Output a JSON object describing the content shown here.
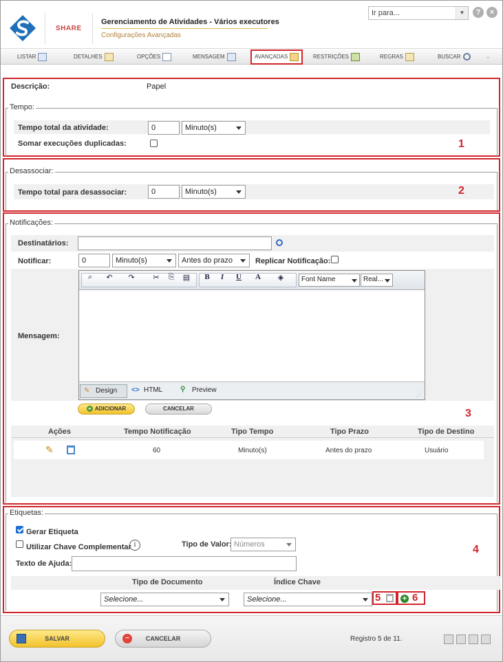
{
  "header": {
    "brand": "SHARE",
    "title": "Gerenciamento de Atividades - Vários executores",
    "subtitle": "Configurações Avançadas",
    "goto_label": "Ir para...",
    "help_icon": "?",
    "close_icon": "×"
  },
  "tabs": [
    {
      "label": "LISTAR"
    },
    {
      "label": "DETALHES"
    },
    {
      "label": "OPÇÕES"
    },
    {
      "label": "MENSAGEM"
    },
    {
      "label": "AVANÇADAS"
    },
    {
      "label": "RESTRIÇÕES"
    },
    {
      "label": "REGRAS"
    },
    {
      "label": "BUSCAR"
    }
  ],
  "section1": {
    "descricao_label": "Descrição:",
    "descricao_value": "Papel",
    "tempo_legend": "Tempo:",
    "tempo_total_label": "Tempo total da atividade:",
    "tempo_total_value": "0",
    "tempo_unit": "Minuto(s)",
    "somar_label": "Somar execuções duplicadas:",
    "number": "1"
  },
  "section2": {
    "legend": "Desassociar:",
    "tempo_label": "Tempo total para desassociar:",
    "tempo_value": "0",
    "tempo_unit": "Minuto(s)",
    "number": "2"
  },
  "section3": {
    "legend": "Notificações:",
    "destinatarios_label": "Destinatários:",
    "notificar_label": "Notificar:",
    "notificar_value": "0",
    "notificar_unit": "Minuto(s)",
    "notificar_prazo": "Antes do prazo",
    "replicar_label": "Replicar Notificação:",
    "mensagem_label": "Mensagem:",
    "font_name": "Font Name",
    "font_size": "Real...",
    "bold": "B",
    "italic": "I",
    "underline": "U",
    "font_color": "A",
    "mode_design": "Design",
    "mode_html": "HTML",
    "mode_preview": "Preview",
    "add_button": "ADICIONAR",
    "cancel_button": "CANCELAR",
    "number": "3",
    "grid_headers": [
      "Ações",
      "Tempo Notificação",
      "Tipo Tempo",
      "Tipo Prazo",
      "Tipo de Destino"
    ],
    "grid_rows": [
      {
        "tempo": "60",
        "tipo_tempo": "Minuto(s)",
        "tipo_prazo": "Antes do prazo",
        "tipo_destino": "Usuário"
      }
    ]
  },
  "section4": {
    "legend": "Etiquetas:",
    "gerar_label": "Gerar Etiqueta",
    "utilizar_label": "Utilizar Chave Complementar",
    "tipo_valor_label": "Tipo de Valor:",
    "tipo_valor_value": "Números",
    "texto_ajuda_label": "Texto de Ajuda:",
    "tipo_documento_header": "Tipo de Documento",
    "indice_chave_header": "Índice Chave",
    "tipo_documento_value": "Selecione...",
    "indice_chave_value": "Selecione...",
    "number": "4",
    "marker5": "5",
    "marker6": "6"
  },
  "footer": {
    "save_button": "SALVAR",
    "cancel_button": "CANCELAR",
    "registro": "Registro 5 de 11."
  }
}
